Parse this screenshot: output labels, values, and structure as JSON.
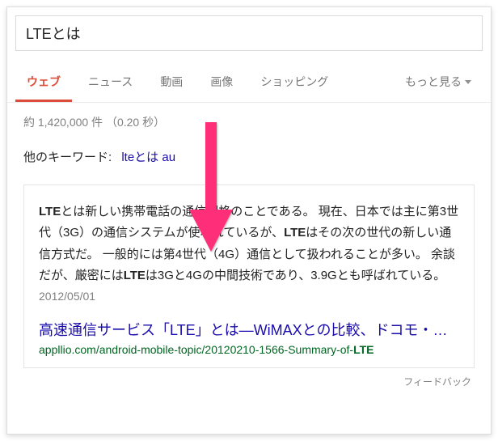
{
  "search": {
    "query": "LTEとは"
  },
  "tabs": {
    "web": "ウェブ",
    "news": "ニュース",
    "video": "動画",
    "image": "画像",
    "shopping": "ショッピング",
    "more": "もっと見る"
  },
  "stats": "約 1,420,000 件 （0.20 秒）",
  "related": {
    "label": "他のキーワード:",
    "link": "lteとは au"
  },
  "answer": {
    "snippet_pre_b1": "",
    "b1": "LTE",
    "snippet_1": "とは新しい携帯電話の通信規格のことである。 現在、日本では主に第3世代（3G）の通信システムが使われているが、",
    "b2": "LTE",
    "snippet_2": "はその次の世代の新しい通信方式だ。 一般的には第4世代（4G）通信として扱われることが多い。 余談だが、厳密には",
    "b3": "LTE",
    "snippet_3": "は3Gと4Gの中間技術であり、3.9Gとも呼ばれている。",
    "date": "2012/05/01",
    "title": "高速通信サービス「LTE」とは―WiMAXとの比較、ドコモ・…",
    "url_pre": "appllio.com/android-mobile-topic/20120210-1566-Summary-of-",
    "url_b": "LTE"
  },
  "feedback": "フィードバック",
  "overlay": {
    "color": "#ff2d78"
  }
}
